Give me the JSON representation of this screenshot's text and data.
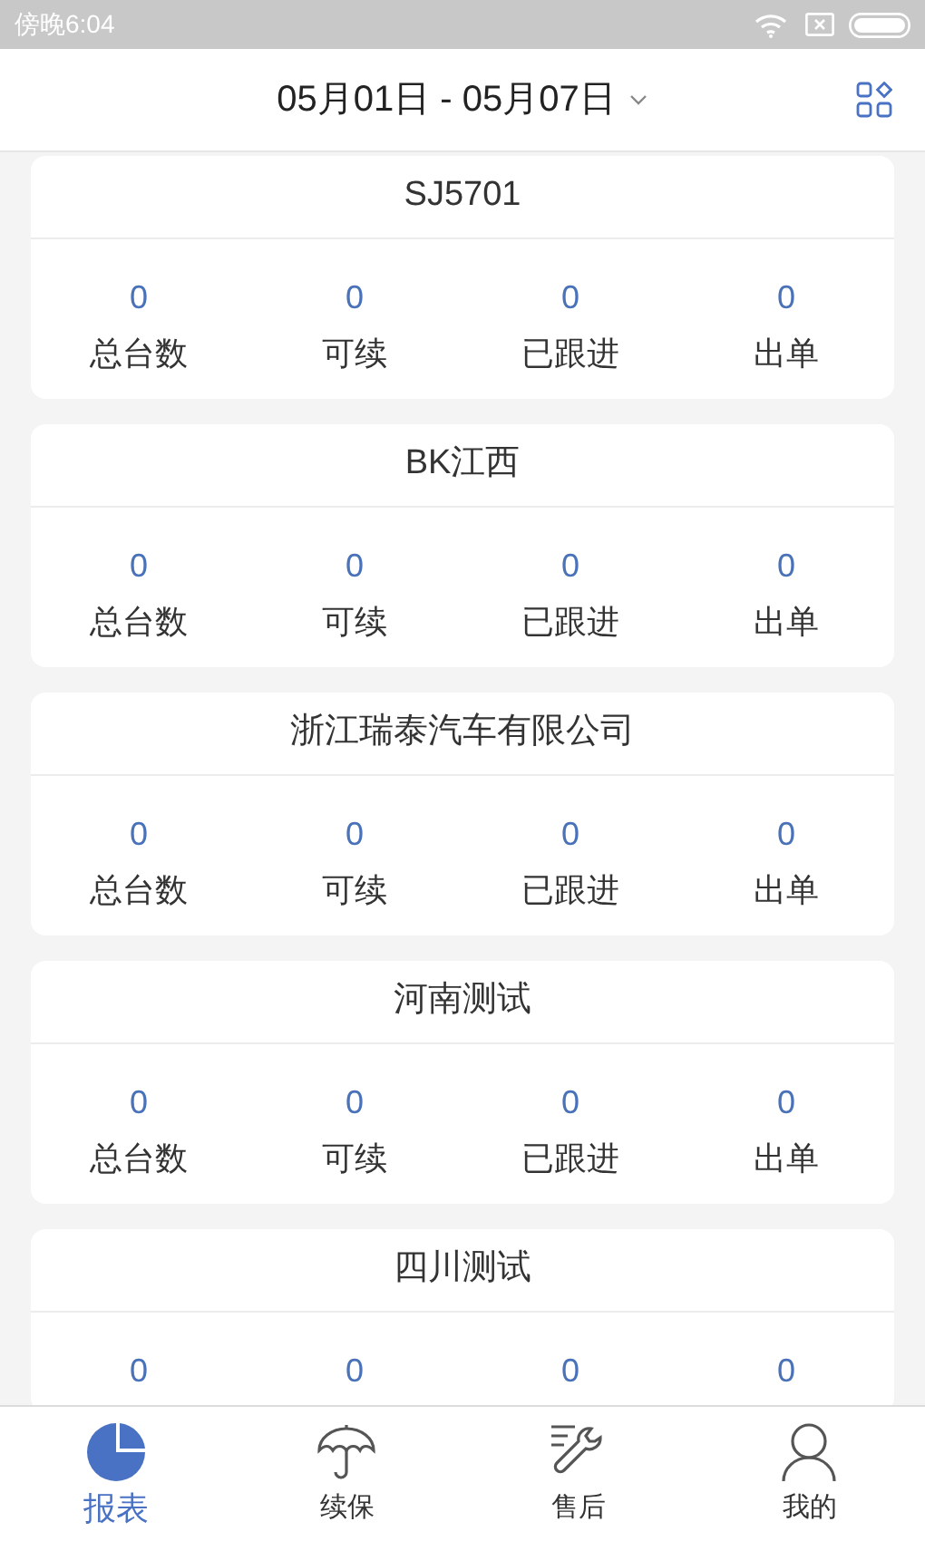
{
  "status_bar": {
    "time": "傍晚6:04"
  },
  "header": {
    "date_range": "05月01日 - 05月07日"
  },
  "cards": [
    {
      "title": "SJ5701",
      "stats": [
        {
          "value": "0",
          "label": "总台数"
        },
        {
          "value": "0",
          "label": "可续"
        },
        {
          "value": "0",
          "label": "已跟进"
        },
        {
          "value": "0",
          "label": "出单"
        }
      ]
    },
    {
      "title": "BK江西",
      "stats": [
        {
          "value": "0",
          "label": "总台数"
        },
        {
          "value": "0",
          "label": "可续"
        },
        {
          "value": "0",
          "label": "已跟进"
        },
        {
          "value": "0",
          "label": "出单"
        }
      ]
    },
    {
      "title": "浙江瑞泰汽车有限公司",
      "stats": [
        {
          "value": "0",
          "label": "总台数"
        },
        {
          "value": "0",
          "label": "可续"
        },
        {
          "value": "0",
          "label": "已跟进"
        },
        {
          "value": "0",
          "label": "出单"
        }
      ]
    },
    {
      "title": "河南测试",
      "stats": [
        {
          "value": "0",
          "label": "总台数"
        },
        {
          "value": "0",
          "label": "可续"
        },
        {
          "value": "0",
          "label": "已跟进"
        },
        {
          "value": "0",
          "label": "出单"
        }
      ]
    },
    {
      "title": "四川测试",
      "stats": [
        {
          "value": "0"
        },
        {
          "value": "0"
        },
        {
          "value": "0"
        },
        {
          "value": "0"
        }
      ]
    }
  ],
  "tabs": [
    {
      "kind": "report",
      "label": "报表",
      "selected": true
    },
    {
      "kind": "renewal",
      "label": "续保",
      "selected": false
    },
    {
      "kind": "service",
      "label": "售后",
      "selected": false
    },
    {
      "kind": "profile",
      "label": "我的",
      "selected": false
    }
  ]
}
